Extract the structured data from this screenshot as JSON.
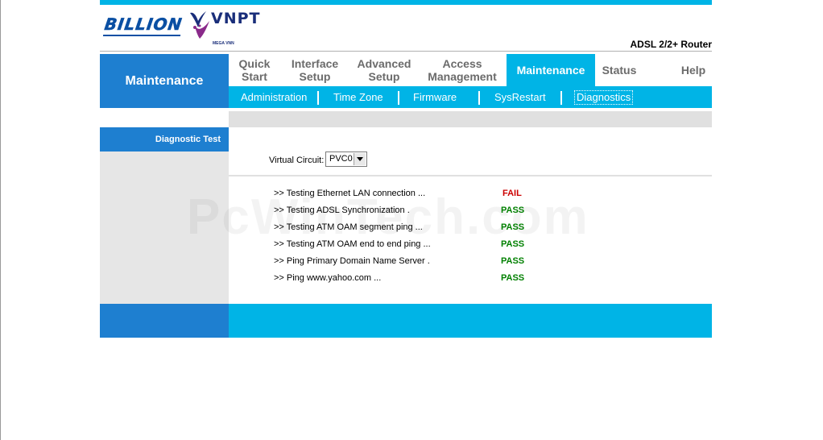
{
  "brand": {
    "billion_logo": "BILLION",
    "vnpt_logo": "VNPT",
    "vnpt_subtext": "MEGA VNN",
    "product_name": "ADSL 2/2+ Router"
  },
  "page_title": "Maintenance",
  "menu": [
    {
      "line1": "Quick",
      "line2": "Start",
      "active": false
    },
    {
      "line1": "Interface",
      "line2": "Setup",
      "active": false
    },
    {
      "line1": "Advanced",
      "line2": "Setup",
      "active": false
    },
    {
      "line1": "Access",
      "line2": "Management",
      "active": false
    },
    {
      "line1": "Maintenance",
      "line2": "",
      "active": true
    },
    {
      "line1": "Status",
      "line2": "",
      "active": false
    },
    {
      "line1": "Help",
      "line2": "",
      "active": false
    }
  ],
  "submenu": [
    {
      "label": "Administration",
      "active": false
    },
    {
      "label": "Time Zone",
      "active": false
    },
    {
      "label": "Firmware",
      "active": false
    },
    {
      "label": "SysRestart",
      "active": false
    },
    {
      "label": "Diagnostics",
      "active": true
    }
  ],
  "sidebar": {
    "heading": "Diagnostic Test"
  },
  "virtual_circuit": {
    "label": "Virtual Circuit:",
    "selected": "PVC0"
  },
  "tests": [
    {
      "label": ">> Testing Ethernet LAN connection ...",
      "result": "FAIL",
      "color": "#cc0000"
    },
    {
      "label": ">> Testing ADSL Synchronization .",
      "result": "PASS",
      "color": "#008000"
    },
    {
      "label": ">> Testing ATM OAM segment ping ...",
      "result": "PASS",
      "color": "#008000"
    },
    {
      "label": ">> Testing ATM OAM end to end ping ...",
      "result": "PASS",
      "color": "#008000"
    },
    {
      "label": ">> Ping Primary Domain Name Server .",
      "result": "PASS",
      "color": "#008000"
    },
    {
      "label": ">> Ping www.yahoo.com ...",
      "result": "PASS",
      "color": "#008000"
    }
  ],
  "watermark": "PcWinTech.com",
  "colors": {
    "accent_cyan": "#00b4e6",
    "accent_blue": "#1e7fd0",
    "pass": "#008000",
    "fail": "#cc0000"
  }
}
